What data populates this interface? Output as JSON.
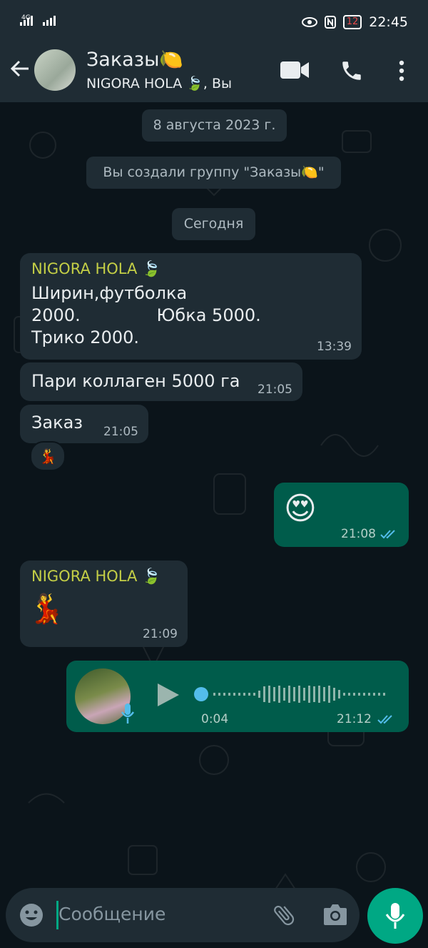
{
  "status_bar": {
    "network": "4G",
    "time": "22:45",
    "battery": "12"
  },
  "header": {
    "title": "Заказы🍋",
    "subtitle": "NIGORA HOLA 🍃, Вы"
  },
  "chat": {
    "date_pill": "8 августа 2023 г.",
    "system_message": "Вы создали группу \"Заказы🍋\"",
    "today_pill": "Сегодня",
    "messages": [
      {
        "sender": "NIGORA HOLA 🍃",
        "text": "Ширин,футболка\n2000.              Юбка 5000.\nТрико 2000.",
        "time": "13:39"
      },
      {
        "text": "Пари коллаген 5000 га",
        "time": "21:05"
      },
      {
        "text": "Заказ",
        "time": "21:05",
        "reaction": "💃"
      },
      {
        "text": "😍",
        "time": "21:08"
      },
      {
        "sender": "NIGORA HOLA 🍃",
        "text": "💃",
        "time": "21:09"
      },
      {
        "duration": "0:04",
        "time": "21:12"
      }
    ]
  },
  "input": {
    "placeholder": "Сообщение"
  },
  "colors": {
    "accent": "#00a884",
    "outgoing_bubble": "#005c4b",
    "incoming_bubble": "#1f2c34",
    "sender_name": "#c4cf46",
    "read_ticks": "#53bdeb"
  }
}
